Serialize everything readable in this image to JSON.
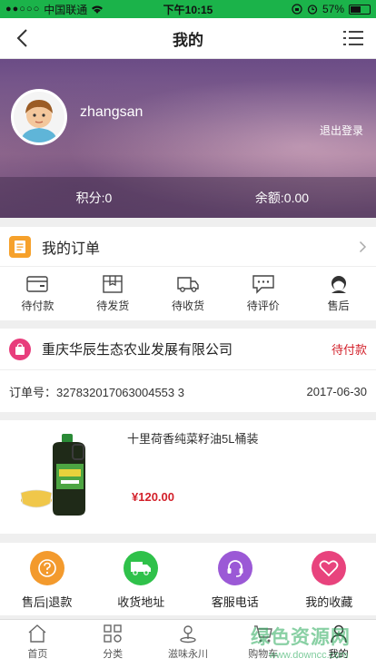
{
  "status_bar": {
    "signal": "●●○○○",
    "carrier": "中国联通",
    "time": "下午10:15",
    "battery_text": "57%",
    "battery_level": 0.57
  },
  "nav": {
    "title": "我的"
  },
  "profile": {
    "username": "zhangsan",
    "logout_label": "退出登录",
    "points": "积分:0",
    "balance": "余额:0.00"
  },
  "orders": {
    "title": "我的订单",
    "tabs": [
      {
        "label": "待付款",
        "icon": "wallet-icon"
      },
      {
        "label": "待发货",
        "icon": "package-icon"
      },
      {
        "label": "待收货",
        "icon": "truck-icon"
      },
      {
        "label": "待评价",
        "icon": "comment-icon"
      },
      {
        "label": "售后",
        "icon": "headset-person-icon"
      }
    ]
  },
  "order": {
    "shop_name": "重庆华辰生态农业发展有限公司",
    "status": "待付款",
    "order_no": "订单号：327832017063004553 3",
    "date": "2017-06-30",
    "product_name": "十里荷香纯菜籽油5L桶装",
    "price": "¥120.00"
  },
  "services": [
    {
      "label": "售后|退款",
      "icon": "question-icon",
      "color": "#f39a2d"
    },
    {
      "label": "收货地址",
      "icon": "truck-icon",
      "color": "#2fc14a"
    },
    {
      "label": "客服电话",
      "icon": "headset-icon",
      "color": "#9b59d6"
    },
    {
      "label": "我的收藏",
      "icon": "heart-icon",
      "color": "#e8437d"
    }
  ],
  "tabbar": [
    {
      "label": "首页",
      "icon": "home-icon"
    },
    {
      "label": "分类",
      "icon": "category-icon"
    },
    {
      "label": "滋味永川",
      "icon": "location-icon"
    },
    {
      "label": "购物车",
      "icon": "cart-icon"
    },
    {
      "label": "我的",
      "icon": "user-icon"
    }
  ],
  "watermark": {
    "line1": "绿色资源网",
    "line2": "www.downcc.com"
  }
}
